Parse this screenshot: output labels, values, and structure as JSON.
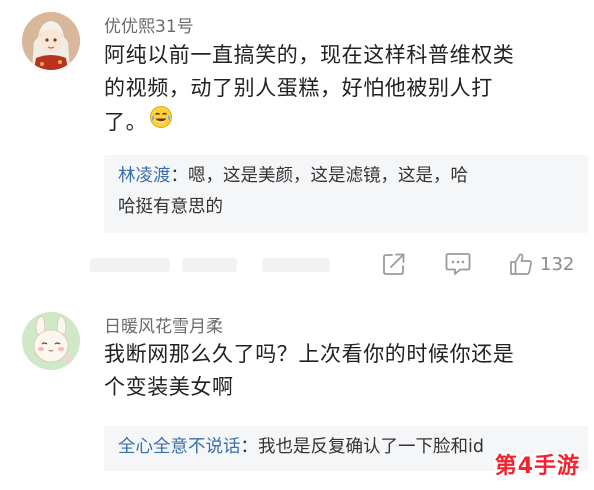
{
  "comments": [
    {
      "username": "优优熙31号",
      "text_line1": "阿纯以前一直搞笑的，现在这样科普维权类",
      "text_line2": "的视频，动了别人蛋糕，好怕他被别人打",
      "text_line3": "了。",
      "emoji": "laugh-cry-emoji",
      "reply": {
        "author": "林凌渡",
        "sep": "：",
        "text_line1": "嗯，这是美颜，这是滤镜，这是，哈",
        "text_line2": "哈挺有意思的"
      },
      "like_count": "132"
    },
    {
      "username": "日暖风花雪月柔",
      "text_line1": "我断网那么久了吗？上次看你的时候你还是",
      "text_line2": "个变装美女啊",
      "reply": {
        "author": "全心全意不说话",
        "sep": "：",
        "text": "我也是反复确认了一下脸和id"
      }
    }
  ],
  "watermark": "第4手游",
  "colors": {
    "username": "#6a6a6a",
    "reply_author": "#3a6fb0",
    "reply_bg": "#f5f6f8",
    "icon": "#9a9a9a",
    "watermark": "#f5222d"
  }
}
